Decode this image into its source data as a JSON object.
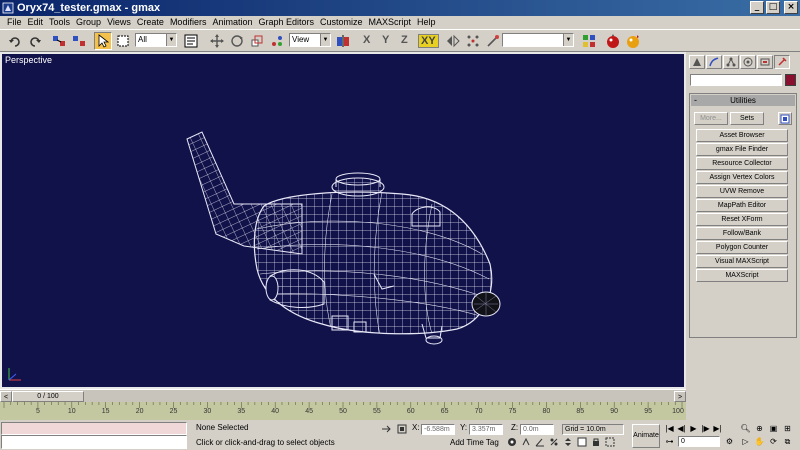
{
  "window": {
    "title": "Oryx74_tester.gmax - gmax",
    "minimize": "_",
    "maximize": "□",
    "close": "×"
  },
  "menu": [
    "File",
    "Edit",
    "Tools",
    "Group",
    "Views",
    "Create",
    "Modifiers",
    "Animation",
    "Graph Editors",
    "Customize",
    "MAXScript",
    "Help"
  ],
  "toolbar": {
    "selection_filter": "All",
    "reference_coord": "View",
    "axis_x": "X",
    "axis_y": "Y",
    "axis_z": "Z",
    "axis_xy": "XY",
    "named_selection": ""
  },
  "viewport": {
    "label": "Perspective",
    "background": "#12124a",
    "wire_color": "#e0e0f0"
  },
  "command_panel": {
    "rollout_title": "Utilities",
    "rollout_toggle": "-",
    "more_label": "More...",
    "sets_label": "Sets",
    "utilities": [
      "Asset Browser",
      "gmax File Finder",
      "Resource Collector",
      "Assign Vertex Colors",
      "UVW Remove",
      "MapPath Editor",
      "Reset XForm",
      "Follow/Bank",
      "Polygon Counter",
      "Visual MAXScript",
      "MAXScript"
    ],
    "object_color": "#8a1030"
  },
  "time_slider": {
    "thumb": "0 / 100",
    "prev_arrow": "<",
    "next_arrow": ">"
  },
  "trackbar": {
    "ticks": [
      "5",
      "10",
      "15",
      "20",
      "25",
      "30",
      "35",
      "40",
      "45",
      "50",
      "55",
      "60",
      "65",
      "70",
      "75",
      "80",
      "85",
      "90",
      "95",
      "100"
    ]
  },
  "status": {
    "selection": "None Selected",
    "prompt": "Click or click-and-drag to select objects",
    "x_label": "X:",
    "x_value": "-6.588m",
    "y_label": "Y:",
    "y_value": "3.357m",
    "z_label": "Z:",
    "z_value": "0.0m",
    "grid": "Grid = 10.0m",
    "add_time_tag": "Add Time Tag",
    "animate": "Animate",
    "frame_value": "0"
  }
}
